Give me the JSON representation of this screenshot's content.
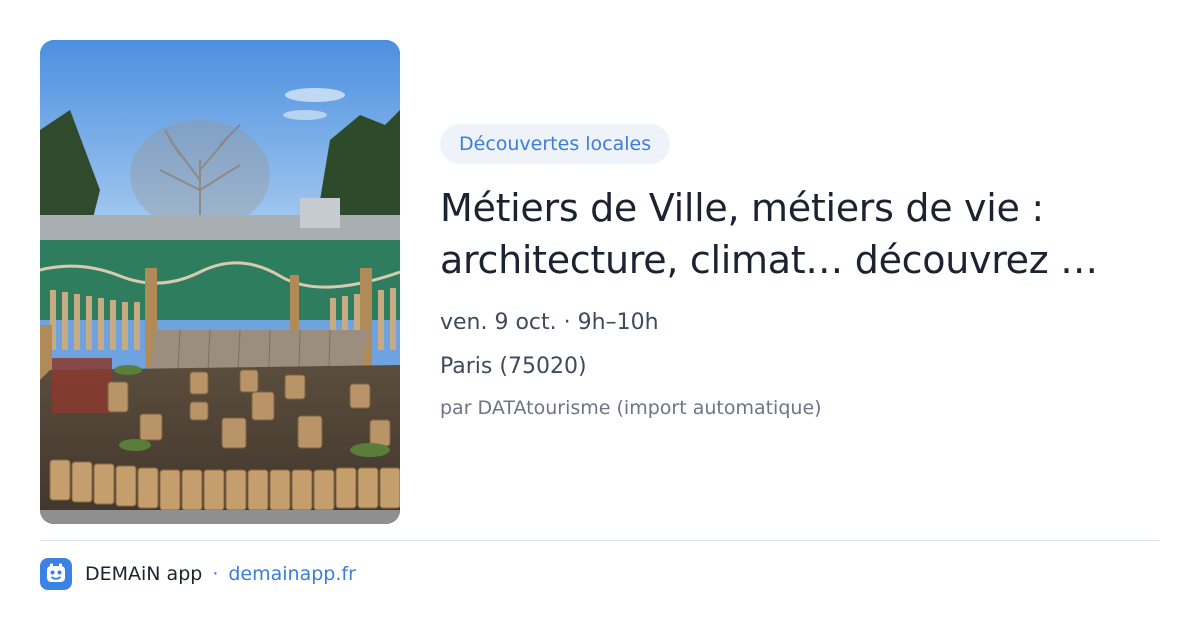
{
  "event": {
    "category": "Découvertes locales",
    "title_line1": "Métiers de Ville, métiers de vie :",
    "title_line2": "architecture, climat… découvrez …",
    "date": "ven. 9 oct. · 9h–10h",
    "location": "Paris (75020)",
    "source": "par DATAtourisme (import automatique)"
  },
  "footer": {
    "app_name": "DEMAiN app",
    "separator": "·",
    "domain": "demainapp.fr",
    "app_icon": "app-logo-icon"
  },
  "colors": {
    "accent": "#3b7ddd",
    "tag_bg": "#eef3fa",
    "title": "#1c2330",
    "meta": "#3f4a5a",
    "source": "#6b7585"
  }
}
